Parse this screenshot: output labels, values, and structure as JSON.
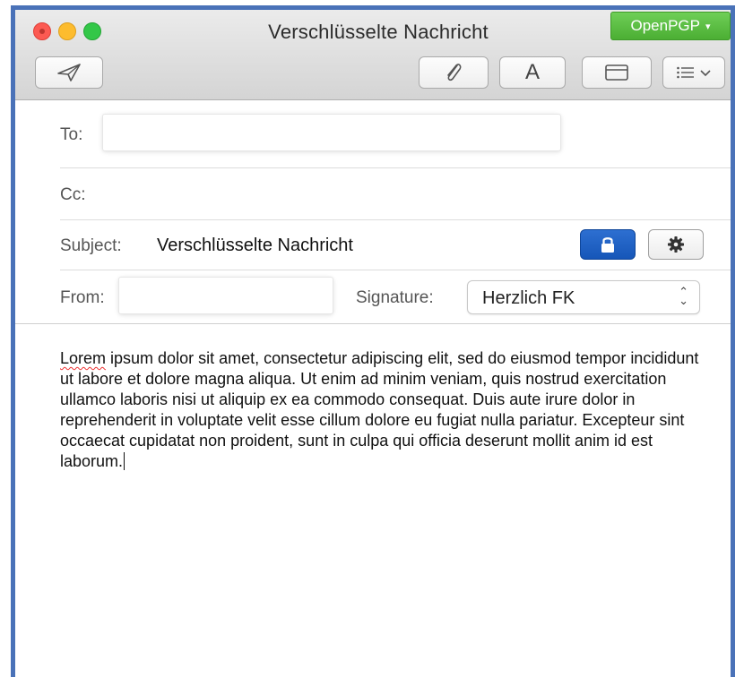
{
  "window": {
    "title": "Verschlüsselte Nachricht",
    "openpgp_label": "OpenPGP",
    "openpgp_caret": "▾"
  },
  "toolbar": {
    "font_label": "A",
    "icons": [
      "send-icon",
      "paperclip-icon",
      "font-icon",
      "window-icon",
      "format-list-icon"
    ]
  },
  "fields": {
    "to_label": "To:",
    "to_value": "",
    "cc_label": "Cc:",
    "subject_label": "Subject:",
    "subject_value": "Verschlüsselte Nachricht",
    "from_label": "From:",
    "from_value": "",
    "signature_label": "Signature:",
    "signature_value": "Herzlich FK"
  },
  "message": {
    "first_word": "Lorem",
    "rest": " ipsum dolor sit amet, consectetur adipiscing elit, sed do eiusmod tempor incididunt ut labore et dolore magna aliqua. Ut enim ad minim veniam, quis nostrud exercitation ullamco laboris nisi ut aliquip ex ea commodo consequat. Duis aute irure dolor in reprehenderit in voluptate velit esse cillum dolore eu fugiat nulla pariatur. Excepteur sint occaecat cupidatat non proident, sunt in culpa qui officia deserunt mollit anim id est laborum."
  },
  "colors": {
    "encrypt_button": "#1656b8",
    "openpgp_green": "#4bae33",
    "frame_border": "#4a72b8"
  }
}
